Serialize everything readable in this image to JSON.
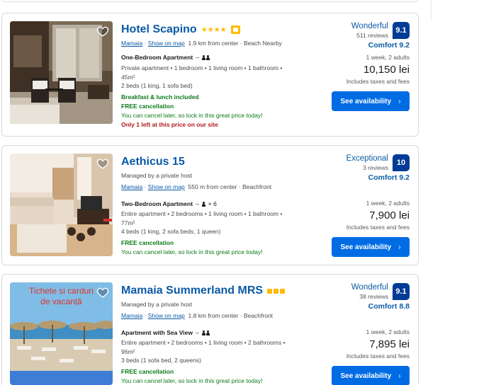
{
  "currency_note": "lei",
  "cards": [
    {
      "name": "Hotel Scapino",
      "district": "Mamaia",
      "map_link": "Show on map",
      "distance": "1.9 km from center",
      "feature": "Beach Nearby",
      "unit_type": "One-Bedroom Apartment",
      "unit_desc_1": "Private apartment • 1 bedroom • 1 living room • 1 bathroom •",
      "unit_desc_2": "45m²",
      "beds": "2 beds (1 king, 1 sofa bed)",
      "meal": "Breakfast & lunch included",
      "cancellation": "FREE cancellation",
      "cancel_note": "You can cancel later, so lock in this great price today!",
      "scarcity": "Only 1 left at this price on our site",
      "review_word": "Wonderful",
      "review_count": "511 reviews",
      "score": "9.1",
      "comfort": "Comfort 9.2",
      "stay": "1 week, 2 adults",
      "price": "10,150 lei",
      "tax_note": "Includes taxes and fees",
      "cta": "See availability",
      "star_count": 4,
      "stars_text": "★★★★"
    },
    {
      "name": "Aethicus 15",
      "host": "Managed by a private host",
      "district": "Mamaia",
      "map_link": "Show on map",
      "distance": "550 m from center",
      "feature": "Beachfront",
      "unit_type": "Two-Bedroom Apartment",
      "guests_mult": "× 6",
      "unit_desc_1": "Entire apartment • 2 bedrooms • 1 living room • 1 bathroom •",
      "unit_desc_2": "77m²",
      "beds": "4 beds (1 king, 2 sofa beds, 1 queen)",
      "cancellation": "FREE cancellation",
      "cancel_note": "You can cancel later, so lock in this great price today!",
      "review_word": "Exceptional",
      "review_count": "3 reviews",
      "score": "10",
      "comfort": "Comfort 9.2",
      "stay": "1 week, 2 adults",
      "price": "7,900 lei",
      "tax_note": "Includes taxes and fees",
      "cta": "See availability"
    },
    {
      "name": "Mamaia Summerland MRS",
      "host": "Managed by a private host",
      "district": "Mamaia",
      "map_link": "Show on map",
      "distance": "1.8 km from center",
      "feature": "Beachfront",
      "unit_type": "Apartment with Sea View",
      "unit_desc_1": "Entire apartment • 2 bedrooms • 1 living room • 2 bathrooms •",
      "unit_desc_2": "96m²",
      "beds": "3 beds (1 sofa bed, 2 queens)",
      "cancellation": "FREE cancellation",
      "cancel_note": "You can cancel later, so lock in this great price today!",
      "review_word": "Wonderful",
      "review_count": "38 reviews",
      "score": "9.1",
      "comfort": "Comfort 8.8",
      "stay": "1 week, 2 adults",
      "price": "7,895 lei",
      "tax_note": "Includes taxes and fees",
      "cta": "See availability",
      "photo_caption_1": "Tichete si carduri",
      "photo_caption_2": "de vacanță",
      "square_rating": 3
    }
  ],
  "colors": {
    "link_blue": "#0a5aa6",
    "score_bg": "#003b95",
    "button_bg": "#006ce4",
    "green": "#0b7a19",
    "red": "#b3181b",
    "star_yellow": "#febb02"
  },
  "icons": {
    "favorite": "heart-icon",
    "guests": "person-icon",
    "chevron": "chevron-right-icon",
    "preferred": "thumbs-up-icon"
  }
}
